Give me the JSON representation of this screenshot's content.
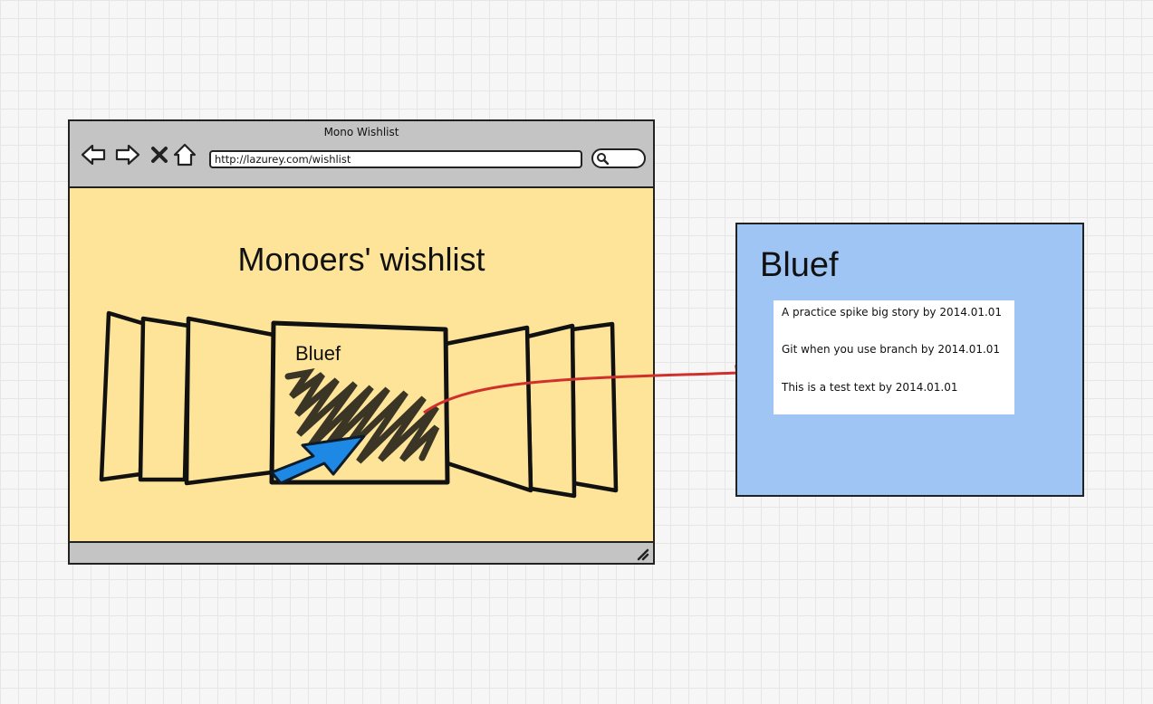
{
  "browser": {
    "window_title": "Mono Wishlist",
    "url": "http://lazurey.com/wishlist"
  },
  "page": {
    "heading": "Monoers' wishlist",
    "center_card_title": "Bluef"
  },
  "detail_panel": {
    "title": "Bluef",
    "items": [
      "A practice spike big story by 2014.01.01",
      "Git when you use branch by 2014.01.01",
      "This is a test text by 2014.01.01"
    ]
  },
  "icons": {
    "back": "back-arrow-icon",
    "forward": "forward-arrow-icon",
    "stop": "close-icon",
    "home": "home-icon",
    "search": "search-icon",
    "resize": "resize-grip-icon",
    "cursor": "pointer-arrow-icon"
  },
  "colors": {
    "canvas_background": "#f6f6f6",
    "window_background": "#fde499",
    "toolbar": "#c4c4c4",
    "detail_panel": "#9fc5f5",
    "connector_arrow": "#d0302c",
    "pointer_arrow": "#1e88e5",
    "scribble": "#3b3526"
  }
}
